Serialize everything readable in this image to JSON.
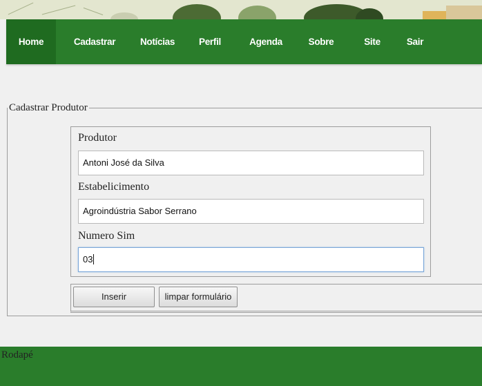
{
  "nav": {
    "items": [
      {
        "label": "Home",
        "active": true
      },
      {
        "label": "Cadastrar"
      },
      {
        "label": "Notícias"
      },
      {
        "label": "Perfil"
      },
      {
        "label": "Agenda"
      },
      {
        "label": "Sobre"
      },
      {
        "label": "Site"
      },
      {
        "label": "Sair"
      }
    ]
  },
  "form": {
    "legend": "Cadastrar Produtor",
    "produtor": {
      "label": "Produtor",
      "value": "Antoni José da Silva"
    },
    "estabelecimento": {
      "label": "Estabelicimento",
      "value": "Agroindústria Sabor Serrano"
    },
    "numero_sim": {
      "label": "Numero Sim",
      "value": "03"
    },
    "submit_label": "Inserir",
    "reset_label": "limpar formulário"
  },
  "footer": {
    "text": "Rodapé"
  },
  "colors": {
    "nav_green": "#2a7d2b",
    "nav_active": "#1f6b20",
    "footer_green": "#2a7d2b"
  }
}
